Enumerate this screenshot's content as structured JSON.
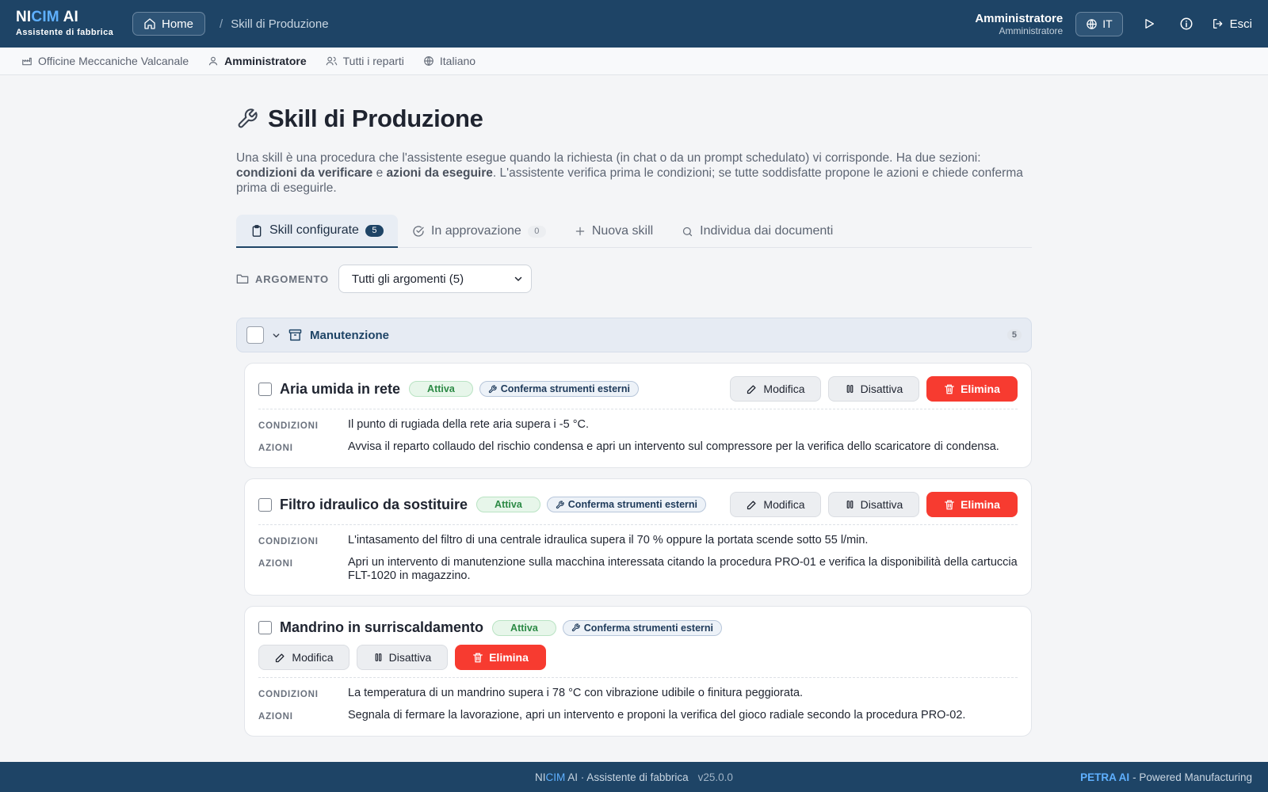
{
  "header": {
    "brand_prefix": "NI",
    "brand_accent": "CIM",
    "brand_suffix": " AI",
    "brand_sub": "Assistente di fabbrica",
    "home_label": "Home",
    "breadcrumb_sep": "/",
    "breadcrumb_current": "Skill di Produzione",
    "user_name": "Amministratore",
    "user_role": "Amministratore",
    "lang_label": "IT",
    "logout_label": "Esci"
  },
  "subbar": {
    "company": "Officine Meccaniche Valcanale",
    "role": "Amministratore",
    "departments": "Tutti i reparti",
    "language": "Italiano"
  },
  "page": {
    "title": "Skill di Produzione",
    "desc_1": "Una skill è una procedura che l'assistente esegue quando la richiesta (in chat o da un prompt schedulato) vi corrisponde. Ha due sezioni: ",
    "desc_b1": "condizioni da verificare",
    "desc_2": " e ",
    "desc_b2": "azioni da eseguire",
    "desc_3": ". L'assistente verifica prima le condizioni; se tutte soddisfatte propone le azioni e chiede conferma prima di eseguirle."
  },
  "tabs": [
    {
      "label": "Skill configurate",
      "count": "5"
    },
    {
      "label": "In approvazione",
      "count": "0"
    },
    {
      "label": "Nuova skill"
    },
    {
      "label": "Individua dai documenti"
    }
  ],
  "filter": {
    "label": "ARGOMENTO",
    "selected": "Tutti gli argomenti (5)"
  },
  "group": {
    "name": "Manutenzione",
    "count": "5"
  },
  "labels": {
    "conditions": "CONDIZIONI",
    "actions": "AZIONI",
    "edit": "Modifica",
    "disable": "Disattiva",
    "delete": "Elimina",
    "active": "Attiva",
    "tool_confirm": "Conferma strumenti esterni"
  },
  "skills": [
    {
      "title": "Aria umida in rete",
      "conditions": "Il punto di rugiada della rete aria supera i -5 °C.",
      "actions": "Avvisa il reparto collaudo del rischio condensa e apri un intervento sul compressore per la verifica dello scaricatore di condensa."
    },
    {
      "title": "Filtro idraulico da sostituire",
      "conditions": "L'intasamento del filtro di una centrale idraulica supera il 70 % oppure la portata scende sotto 55 l/min.",
      "actions": "Apri un intervento di manutenzione sulla macchina interessata citando la procedura PRO-01 e verifica la disponibilità della cartuccia FLT-1020 in magazzino."
    },
    {
      "title": "Mandrino in surriscaldamento",
      "conditions": "La temperatura di un mandrino supera i 78 °C con vibrazione udibile o finitura peggiorata.",
      "actions": "Segnala di fermare la lavorazione, apri un intervento e proponi la verifica del gioco radiale secondo la procedura PRO-02."
    }
  ],
  "footer": {
    "brand_prefix": "NI",
    "brand_accent": "CIM",
    "brand_rest": " AI · Assistente di fabbrica",
    "version": "v25.0.0",
    "right_brand": "PETRA AI",
    "right_text": "- Powered Manufacturing"
  },
  "colors": {
    "primary": "#1e4466",
    "accent": "#5fb0ff",
    "danger": "#f73b30",
    "success": "#2c8a45"
  }
}
